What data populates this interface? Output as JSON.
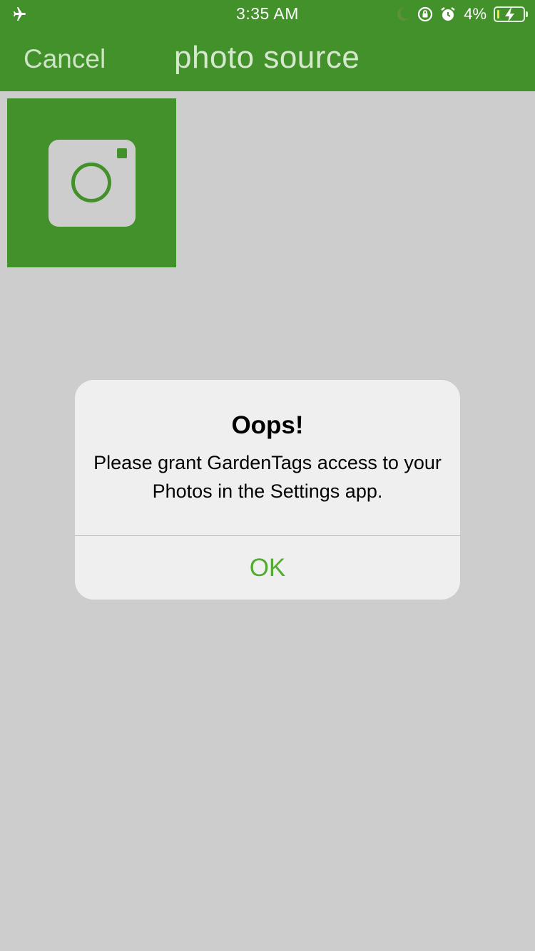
{
  "status_bar": {
    "time": "3:35 AM",
    "battery_percent": "4%",
    "battery_level": 0.04,
    "icons": [
      "airplane-icon",
      "moon-icon",
      "orientation-lock-icon",
      "alarm-icon",
      "battery-charging-icon"
    ]
  },
  "nav": {
    "cancel_label": "Cancel",
    "title": "photo source"
  },
  "grid": {
    "items": [
      {
        "icon": "camera-icon"
      }
    ]
  },
  "alert": {
    "title": "Oops!",
    "message": "Please grant GardenTags access to your Photos in the Settings app.",
    "ok_label": "OK"
  },
  "colors": {
    "brand_green": "#43912a",
    "background": "#cdcdcd",
    "alert_bg": "#efefef",
    "ok_text": "#52ad2f"
  }
}
